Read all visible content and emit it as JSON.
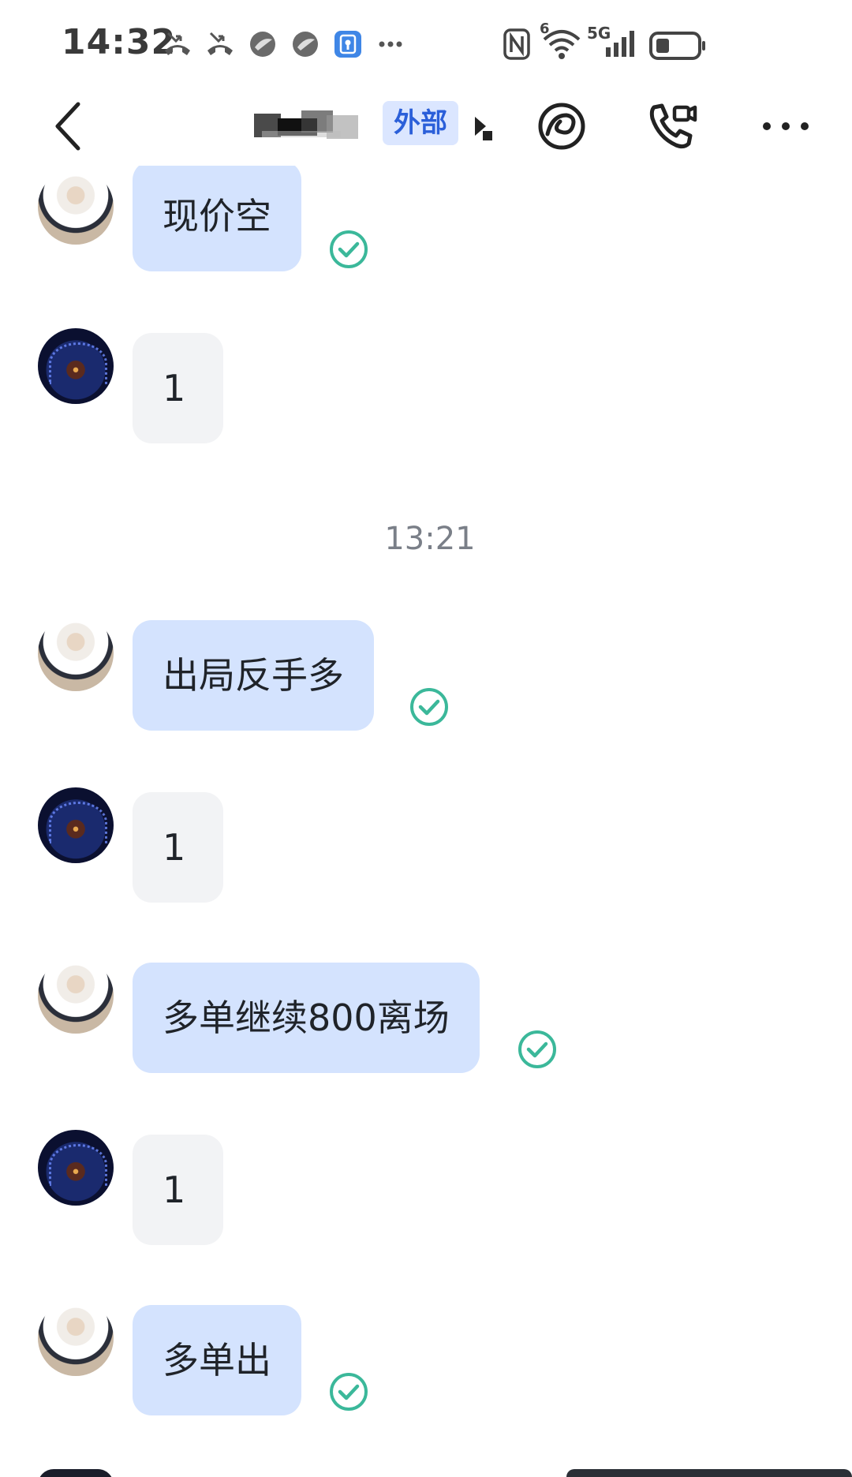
{
  "status_bar": {
    "time": "14:32",
    "left_icons": [
      "missed-call-icon",
      "missed-call-icon",
      "app-notification-icon",
      "app-notification-icon",
      "vpn-key-icon",
      "more-dots-icon"
    ],
    "network": "5G",
    "wifi_badge": "6"
  },
  "nav": {
    "badge": "外部"
  },
  "messages": [
    {
      "kind": "self",
      "text": "现价空",
      "read": true
    },
    {
      "kind": "other",
      "text": "1"
    },
    {
      "kind": "time",
      "text": "13:21"
    },
    {
      "kind": "self",
      "text": "出局反手多",
      "read": true
    },
    {
      "kind": "other",
      "text": "1"
    },
    {
      "kind": "self",
      "text": "多单继续800离场",
      "read": true
    },
    {
      "kind": "other",
      "text": "1"
    },
    {
      "kind": "self",
      "text": "多单出",
      "read": true
    }
  ],
  "colors": {
    "self_bubble": "#d4e3fe",
    "other_bubble": "#f2f3f5",
    "read_check": "#3bb89a",
    "badge_bg": "#dbe6ff",
    "badge_text": "#2b5fd9"
  }
}
